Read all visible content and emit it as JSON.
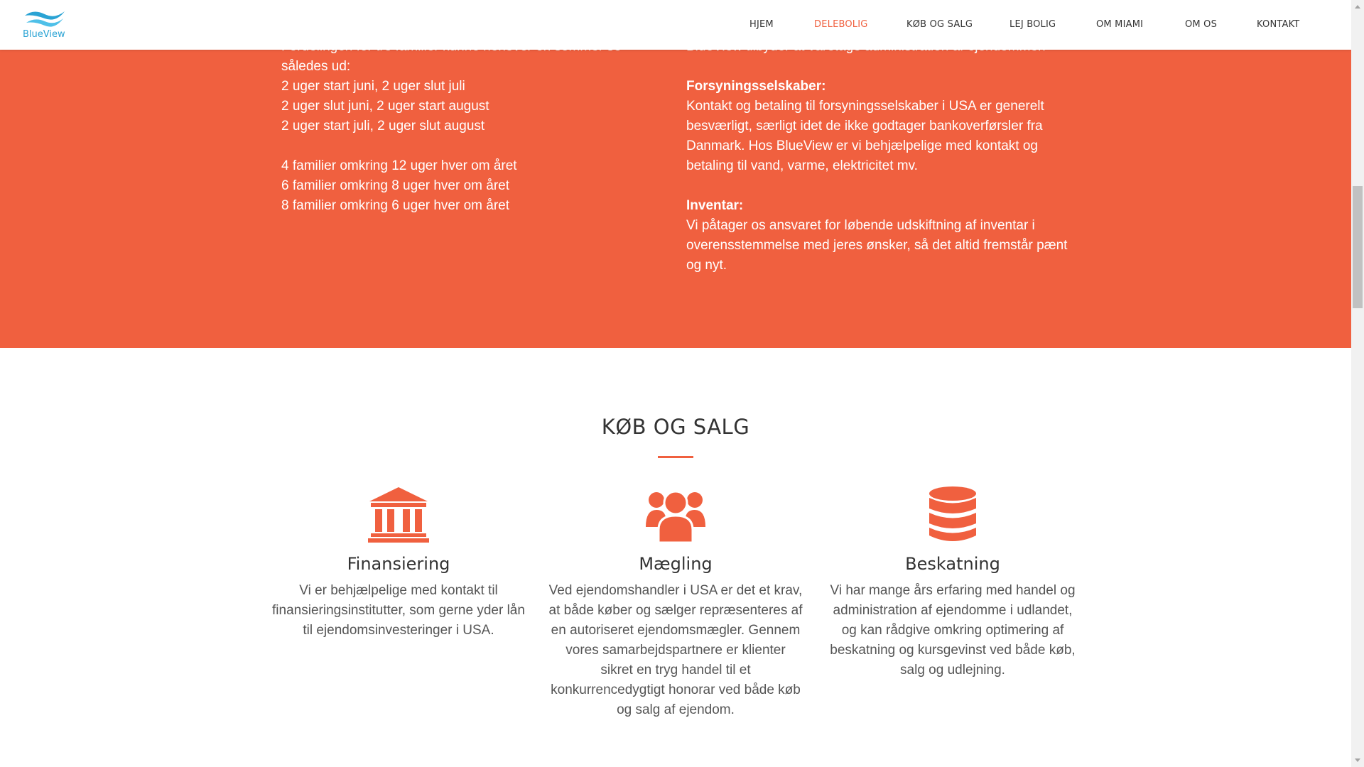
{
  "brand": {
    "name": "BlueView",
    "color": "#2aa3d4"
  },
  "accent_color": "#f0603f",
  "nav": [
    {
      "label": "HJEM",
      "active": false
    },
    {
      "label": "DELEBOLIG",
      "active": true
    },
    {
      "label": "KØB OG SALG",
      "active": false
    },
    {
      "label": "LEJ BOLIG",
      "active": false
    },
    {
      "label": "OM MIAMI",
      "active": false
    },
    {
      "label": "OM OS",
      "active": false
    },
    {
      "label": "KONTAKT",
      "active": false
    }
  ],
  "orange_section": {
    "left": {
      "intro_line1": "Fordelingen for tre familier kunne henover en sommer se",
      "intro_line2": "således ud:",
      "weeks": [
        "2 uger start juni, 2 uger slut juli",
        "2 uger slut juni, 2 uger start august",
        "2 uger start juli, 2 uger slut august"
      ],
      "families": [
        "4 familier omkring 12 uger hver om året",
        "6 familier omkring 8 uger hver om året",
        "8 familier omkring 6 uger hver om året"
      ]
    },
    "right": {
      "intro": "BlueView tilbyder at varetage administration af ejendommen",
      "utilities_heading": "Forsyningsselskaber:",
      "utilities_lines": [
        "Kontakt og betaling til forsyningsselskaber i USA er generelt",
        "besværligt, særligt idet de ikke godtager bankoverførsler fra",
        "Danmark. Hos BlueView er vi behjælpelige med kontakt og",
        "betaling til vand, varme, elektricitet mv."
      ],
      "inventory_heading": "Inventar:",
      "inventory_lines": [
        "Vi påtager os ansvaret for løbende udskiftning af inventar i",
        "overensstemmelse med jeres ønsker, så det altid fremstår pænt",
        "og nyt."
      ]
    }
  },
  "buy_sell": {
    "title": "KØB OG SALG",
    "services": [
      {
        "icon": "bank-icon",
        "title": "Finansiering",
        "lines": [
          "Vi er behjælpelige med kontakt til",
          "finansieringsinstitutter, som gerne yder lån",
          "til ejendomsinvesteringer i USA."
        ]
      },
      {
        "icon": "users-icon",
        "title": "Mægling",
        "lines": [
          "Ved ejendomshandler i USA er det et krav,",
          "at både køber og sælger repræsenteres af",
          "en autoriseret ejendomsmægler. Gennem",
          "vores samarbejdspartnere er klienter",
          "sikret en tryg handel til et",
          "konkurrencedygtigt honorar ved både køb",
          "og salg af ejendom."
        ]
      },
      {
        "icon": "database-icon",
        "title": "Beskatning",
        "lines": [
          "Vi har mange års erfaring med handel og",
          "administration af ejendomme i udlandet,",
          "og kan rådgive omkring optimering af",
          "beskatning og kursgevinst ved både køb,",
          "salg og udlejning."
        ]
      }
    ]
  }
}
